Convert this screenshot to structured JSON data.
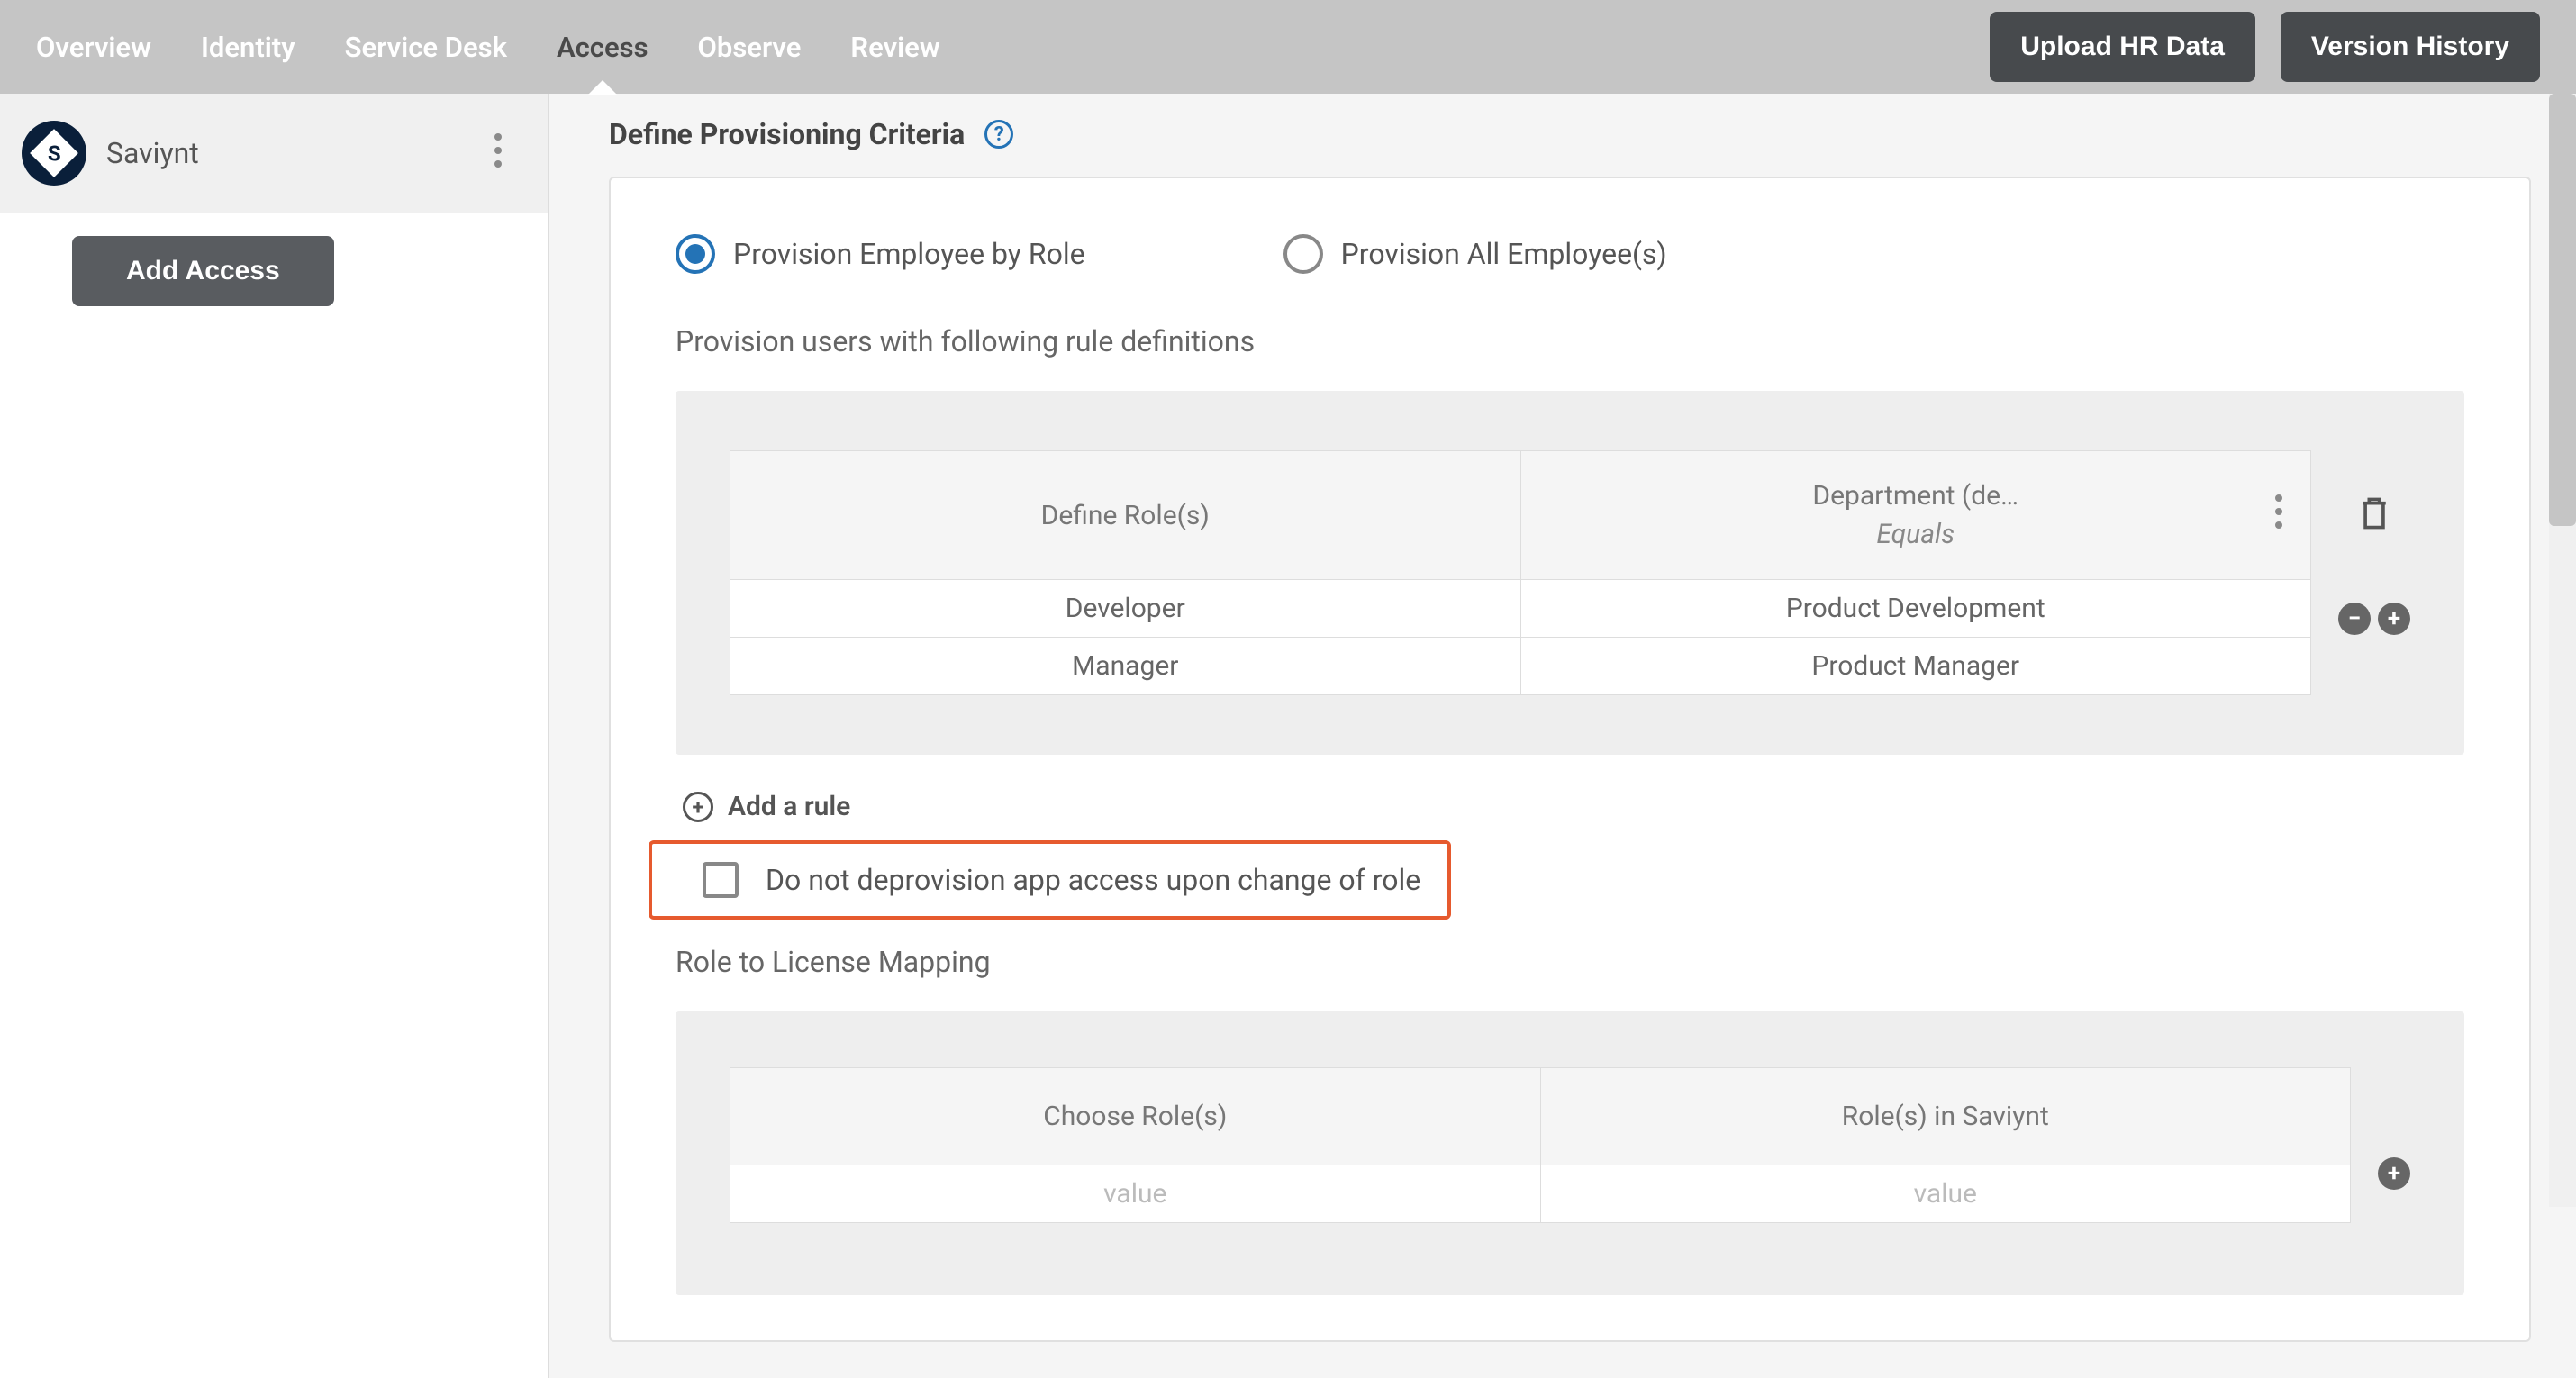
{
  "topnav": {
    "tabs": [
      "Overview",
      "Identity",
      "Service Desk",
      "Access",
      "Observe",
      "Review"
    ],
    "active_index": 3,
    "upload_btn": "Upload HR Data",
    "history_btn": "Version History"
  },
  "sidebar": {
    "app_name": "Saviynt",
    "app_logo_letter": "S",
    "add_access_btn": "Add Access"
  },
  "main": {
    "section_title": "Define Provisioning Criteria",
    "radio": {
      "by_role": "Provision Employee by Role",
      "all": "Provision All Employee(s)",
      "selected": "by_role"
    },
    "rule_subtext": "Provision users with following rule definitions",
    "rule_table": {
      "header_roles": "Define Role(s)",
      "header_dept": "Department (de…",
      "header_dept_sub": "Equals",
      "rows": [
        {
          "role": "Developer",
          "dept": "Product Development"
        },
        {
          "role": "Manager",
          "dept": "Product Manager"
        }
      ]
    },
    "add_rule_label": "Add a rule",
    "checkbox_label": "Do not deprovision app access upon change of role",
    "mapping_title": "Role to License Mapping",
    "map_table": {
      "header_choose": "Choose Role(s)",
      "header_in_app": "Role(s) in Saviynt",
      "placeholder": "value"
    }
  }
}
